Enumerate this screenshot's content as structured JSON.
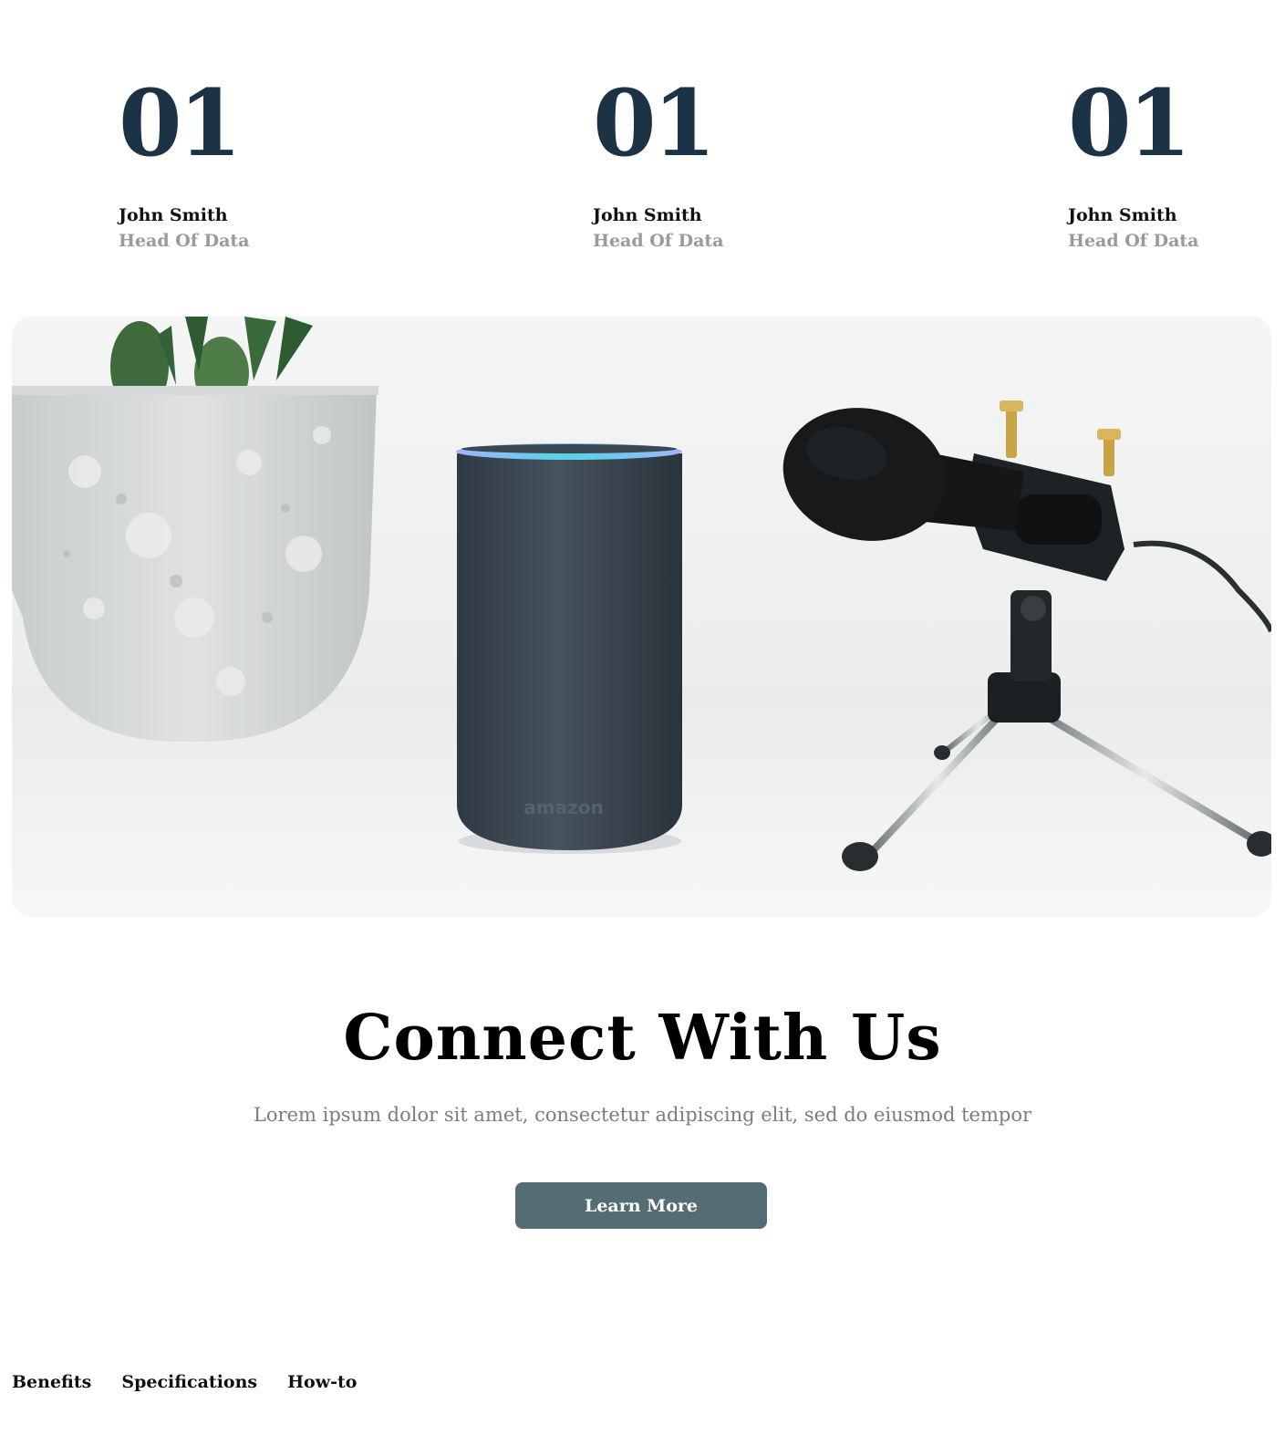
{
  "stats": [
    {
      "number": "01",
      "name": "John Smith",
      "role": "Head Of Data"
    },
    {
      "number": "01",
      "name": "John Smith",
      "role": "Head Of Data"
    },
    {
      "number": "01",
      "name": "John Smith",
      "role": "Head Of Data"
    }
  ],
  "hero": {
    "speaker_brand": "amazon"
  },
  "cta": {
    "title": "Connect With Us",
    "text": "Lorem ipsum dolor sit amet, consectetur adipiscing elit, sed do eiusmod tempor",
    "button_label": "Learn More"
  },
  "footer_nav": [
    "Benefits",
    "Specifications",
    "How-to"
  ],
  "colors": {
    "number": "#1c3346",
    "button": "#546c73",
    "muted": "#9a9a9a"
  }
}
